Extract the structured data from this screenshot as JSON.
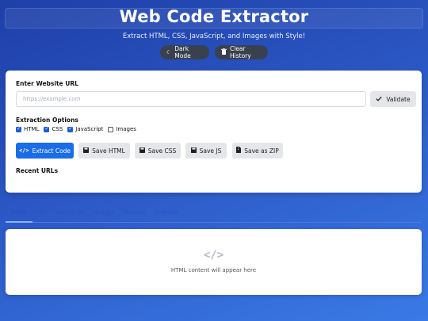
{
  "header": {
    "title": "Web Code Extractor",
    "subtitle": "Extract HTML, CSS, JavaScript, and Images with Style!",
    "dark_mode_label": "Dark Mode",
    "clear_history_label": "Clear History"
  },
  "form": {
    "url_label": "Enter Website URL",
    "url_placeholder": "https://example.com",
    "url_value": "",
    "validate_label": "Validate",
    "options_label": "Extraction Options",
    "options": [
      {
        "label": "HTML",
        "checked": true
      },
      {
        "label": "CSS",
        "checked": true
      },
      {
        "label": "JavaScript",
        "checked": true
      },
      {
        "label": "Images",
        "checked": false
      }
    ],
    "extract_label": "Extract Code",
    "save_html_label": "Save HTML",
    "save_css_label": "Save CSS",
    "save_js_label": "Save JS",
    "save_zip_label": "Save as ZIP",
    "recent_label": "Recent URLs"
  },
  "tabs": [
    "HTML",
    "CSS",
    "JavaScript",
    "Images",
    "Preview",
    "Analysis"
  ],
  "output": {
    "icon_glyph": "</>",
    "placeholder": "HTML content will appear here"
  },
  "colors": {
    "primary": "#1a6ce8",
    "secondary_button": "#e4e6ea",
    "pill_button": "#39414f",
    "background_from": "#1f3fa8",
    "background_to": "#3a7ae6"
  },
  "icons": {
    "dark_mode": "moon-icon",
    "clear_history": "trash-icon",
    "validate": "check-icon",
    "extract": "code-icon",
    "save": "save-icon",
    "zip": "file-zip-icon"
  }
}
